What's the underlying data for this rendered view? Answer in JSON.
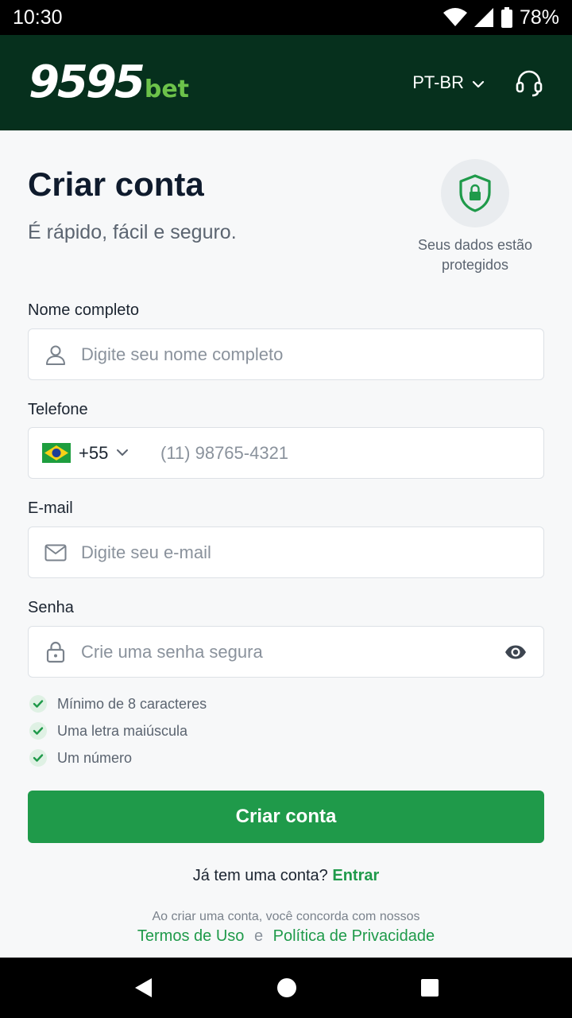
{
  "status_bar": {
    "time": "10:30",
    "battery": "78%"
  },
  "header": {
    "logo_main": "9595",
    "logo_sub": "bet",
    "language": "PT-BR"
  },
  "page": {
    "title": "Criar conta",
    "subtitle": "É rápido, fácil e seguro.",
    "secure_line1": "Seus dados estão",
    "secure_line2": "protegidos"
  },
  "form": {
    "name": {
      "label": "Nome completo",
      "placeholder": "Digite seu nome completo"
    },
    "phone": {
      "label": "Telefone",
      "dial_code": "+55",
      "placeholder": "(11) 98765-4321"
    },
    "email": {
      "label": "E-mail",
      "placeholder": "Digite seu e-mail"
    },
    "password": {
      "label": "Senha",
      "placeholder": "Crie uma senha segura"
    },
    "rules": [
      "Mínimo de 8 caracteres",
      "Uma letra maiúscula",
      "Um número"
    ],
    "submit": "Criar conta"
  },
  "footer": {
    "has_account": "Já tem uma conta?",
    "login_link": "Entrar",
    "terms_text": "Ao criar uma conta, você concorda com nossos",
    "terms_link": "Termos de Uso",
    "conjunction": "e",
    "privacy_link": "Política de Privacidade"
  },
  "icons": {
    "signal": "signal-icon",
    "wifi": "wifi-icon",
    "battery": "battery-icon",
    "support": "headset-icon",
    "shield": "shield-lock-icon",
    "user": "user-icon",
    "mail": "mail-icon",
    "lock": "lock-icon",
    "eye": "eye-icon",
    "check": "check-icon",
    "back": "back-icon",
    "home": "home-icon",
    "recents": "recents-icon"
  },
  "colors": {
    "brand_dark": "#06301d",
    "brand_green": "#1f9a4a",
    "logo_accent": "#6cc24a"
  }
}
